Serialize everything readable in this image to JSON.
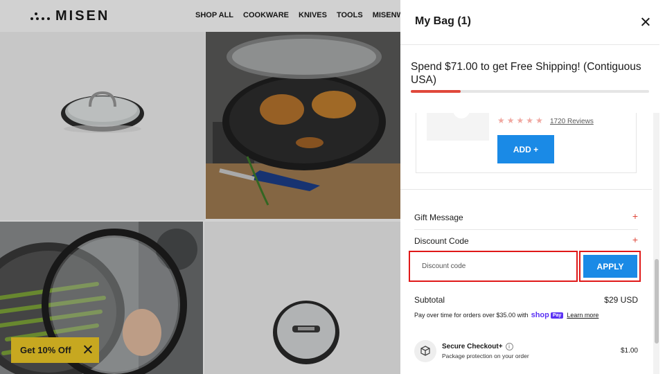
{
  "site": {
    "brand": "MISEN",
    "nav": [
      "SHOP ALL",
      "COOKWARE",
      "KNIVES",
      "TOOLS",
      "MISENWARE"
    ]
  },
  "promo": {
    "label": "Get 10% Off"
  },
  "cart": {
    "title": "My Bag (1)",
    "shipping_message": "Spend $71.00 to get Free Shipping! (Contiguous USA)",
    "shipping_progress": 0.21,
    "upsell": {
      "rating": 5,
      "reviews": "1720 Reviews",
      "add_label": "ADD +"
    },
    "gift_message": {
      "label": "Gift Message",
      "toggle": "+"
    },
    "discount": {
      "label": "Discount Code",
      "toggle": "+",
      "placeholder": "Discount code",
      "apply_label": "APPLY"
    },
    "subtotal": {
      "label": "Subtotal",
      "value": "$29 USD"
    },
    "payover": {
      "text": "Pay over time for orders over $35.00 with",
      "shop": "shop",
      "badge": "Pay",
      "learn_more": "Learn more"
    },
    "secure": {
      "title": "Secure Checkout+",
      "subtitle": "Package protection on your order",
      "price": "$1.00"
    }
  },
  "colors": {
    "accent_blue": "#1a8ae6",
    "accent_red": "#e0483b",
    "highlight_red": "#e01818",
    "promo_gold": "#c7a820",
    "shop_purple": "#5a31f4"
  }
}
